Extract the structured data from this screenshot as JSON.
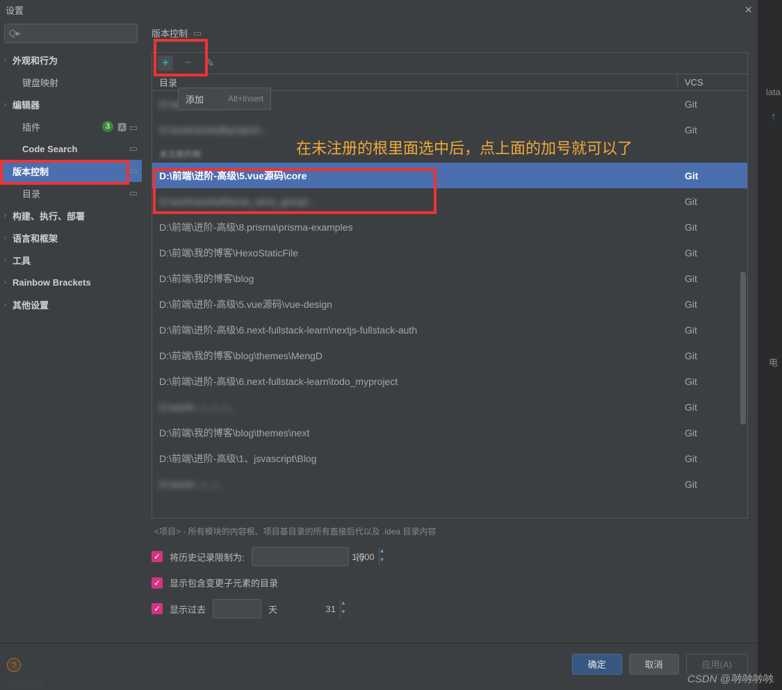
{
  "title": "设置",
  "search_placeholder": "Q▸",
  "sidebar": [
    {
      "label": "外观和行为",
      "arrow": "›",
      "bold": true
    },
    {
      "label": "键盘映射",
      "arrow": "",
      "bold": false,
      "child": true
    },
    {
      "label": "编辑器",
      "arrow": "›",
      "bold": true
    },
    {
      "label": "插件",
      "arrow": "",
      "bold": false,
      "child": true,
      "badge": "3",
      "extra": true
    },
    {
      "label": "Code Search",
      "arrow": "",
      "bold": true,
      "child": true,
      "link": true
    },
    {
      "label": "版本控制",
      "arrow": "›",
      "bold": true,
      "selected": true,
      "link": true
    },
    {
      "label": "目录",
      "arrow": "",
      "bold": false,
      "child": true,
      "link": true
    },
    {
      "label": "构建、执行、部署",
      "arrow": "›",
      "bold": true
    },
    {
      "label": "语言和框架",
      "arrow": "›",
      "bold": true
    },
    {
      "label": "工具",
      "arrow": "›",
      "bold": true
    },
    {
      "label": "Rainbow Brackets",
      "arrow": "›",
      "bold": true
    },
    {
      "label": "其他设置",
      "arrow": "›",
      "bold": true
    }
  ],
  "breadcrumb": "版本控制",
  "toolbar": {
    "add_tooltip": "添加",
    "add_shortcut": "Alt+Insert"
  },
  "columns": {
    "dir": "目录",
    "vcs": "VCS"
  },
  "section_label": "未注册的根:",
  "annotation": "在未注册的根里面选中后，点上面的加号就可以了",
  "rows_top": [
    {
      "path": "D:\\work\\workall\\...",
      "vcs": "Git",
      "blur": true
    },
    {
      "path": "D:\\work\\workall\\project\\...",
      "vcs": "Git",
      "blur": true
    }
  ],
  "selected_row": {
    "path": "D:\\前端\\进阶-高级\\5.vue源码\\core",
    "vcs": "Git"
  },
  "rows": [
    {
      "path": "D:\\work\\workall\\lscas_wms_group\\...",
      "vcs": "Git",
      "blur": true
    },
    {
      "path": "D:\\前端\\进阶-高级\\8.prisma\\prisma-examples",
      "vcs": "Git"
    },
    {
      "path": "D:\\前端\\我的博客\\HexoStaticFile",
      "vcs": "Git"
    },
    {
      "path": "D:\\前端\\我的博客\\blog",
      "vcs": "Git"
    },
    {
      "path": "D:\\前端\\进阶-高级\\5.vue源码\\vue-design",
      "vcs": "Git"
    },
    {
      "path": "D:\\前端\\进阶-高级\\6.next-fullstack-learn\\nextjs-fullstack-auth",
      "vcs": "Git"
    },
    {
      "path": "D:\\前端\\我的博客\\blog\\themes\\MengD",
      "vcs": "Git"
    },
    {
      "path": "D:\\前端\\进阶-高级\\6.next-fullstack-learn\\todo_myproject",
      "vcs": "Git"
    },
    {
      "path": "D:\\work\\...\\...\\...\\...",
      "vcs": "Git",
      "blur": true
    },
    {
      "path": "D:\\前端\\我的博客\\blog\\themes\\next",
      "vcs": "Git"
    },
    {
      "path": "D:\\前端\\进阶-高级\\1、jsvascript\\Blog",
      "vcs": "Git"
    },
    {
      "path": "D:\\work\\...\\...\\...",
      "vcs": "Git",
      "blur": true
    }
  ],
  "hint": "<项目> - 所有模块的内容根、项目基目录的所有直接后代以及 .idea 目录内容",
  "opt1": {
    "label": "将历史记录限制为:",
    "value": "1,000",
    "suffix": "行"
  },
  "opt2": {
    "label": "显示包含变更子元素的目录"
  },
  "opt3": {
    "label": "显示过去",
    "value": "31",
    "suffix": "天"
  },
  "buttons": {
    "ok": "确定",
    "cancel": "取消",
    "apply": "应用(A)"
  },
  "right": {
    "txt": "lata",
    "chn": "电"
  },
  "watermark": "CSDN @呐呐呐呐."
}
